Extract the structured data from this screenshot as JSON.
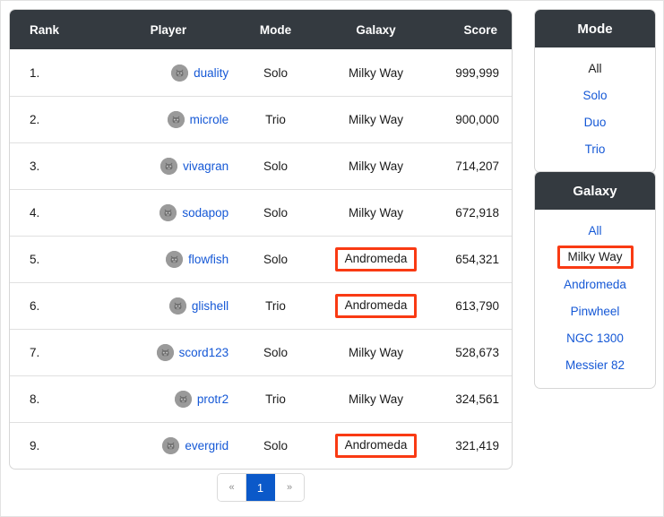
{
  "table": {
    "columns": [
      "Rank",
      "Player",
      "Mode",
      "Galaxy",
      "Score"
    ],
    "rows": [
      {
        "rank": "1.",
        "player": "duality",
        "mode": "Solo",
        "galaxy": "Milky Way",
        "score": "999,999",
        "galaxy_highlighted": false,
        "avatar": "robot-avatar-icon"
      },
      {
        "rank": "2.",
        "player": "microle",
        "mode": "Trio",
        "galaxy": "Milky Way",
        "score": "900,000",
        "galaxy_highlighted": false,
        "avatar": "robot-avatar-icon"
      },
      {
        "rank": "3.",
        "player": "vivagran",
        "mode": "Solo",
        "galaxy": "Milky Way",
        "score": "714,207",
        "galaxy_highlighted": false,
        "avatar": "robot-avatar-icon"
      },
      {
        "rank": "4.",
        "player": "sodapop",
        "mode": "Solo",
        "galaxy": "Milky Way",
        "score": "672,918",
        "galaxy_highlighted": false,
        "avatar": "robot-avatar-icon"
      },
      {
        "rank": "5.",
        "player": "flowfish",
        "mode": "Solo",
        "galaxy": "Andromeda",
        "score": "654,321",
        "galaxy_highlighted": true,
        "avatar": "robot-avatar-icon"
      },
      {
        "rank": "6.",
        "player": "glishell",
        "mode": "Trio",
        "galaxy": "Andromeda",
        "score": "613,790",
        "galaxy_highlighted": true,
        "avatar": "robot-avatar-icon"
      },
      {
        "rank": "7.",
        "player": "scord123",
        "mode": "Solo",
        "galaxy": "Milky Way",
        "score": "528,673",
        "galaxy_highlighted": false,
        "avatar": "robot-avatar-icon"
      },
      {
        "rank": "8.",
        "player": "protr2",
        "mode": "Trio",
        "galaxy": "Milky Way",
        "score": "324,561",
        "galaxy_highlighted": false,
        "avatar": "robot-avatar-icon"
      },
      {
        "rank": "9.",
        "player": "evergrid",
        "mode": "Solo",
        "galaxy": "Andromeda",
        "score": "321,419",
        "galaxy_highlighted": true,
        "avatar": "robot-avatar-icon"
      }
    ]
  },
  "pagination": {
    "prev_label": "«",
    "next_label": "»",
    "pages": [
      {
        "label": "1",
        "active": true
      }
    ],
    "current_page": "1"
  },
  "filters": {
    "mode": {
      "title": "Mode",
      "items": [
        {
          "label": "All",
          "active": true,
          "highlighted": false
        },
        {
          "label": "Solo",
          "active": false,
          "highlighted": false
        },
        {
          "label": "Duo",
          "active": false,
          "highlighted": false
        },
        {
          "label": "Trio",
          "active": false,
          "highlighted": false
        }
      ]
    },
    "galaxy": {
      "title": "Galaxy",
      "items": [
        {
          "label": "All",
          "active": false,
          "highlighted": false
        },
        {
          "label": "Milky Way",
          "active": true,
          "highlighted": true
        },
        {
          "label": "Andromeda",
          "active": false,
          "highlighted": false
        },
        {
          "label": "Pinwheel",
          "active": false,
          "highlighted": false
        },
        {
          "label": "NGC 1300",
          "active": false,
          "highlighted": false
        },
        {
          "label": "Messier 82",
          "active": false,
          "highlighted": false
        }
      ]
    }
  },
  "colors": {
    "header_bg": "#343a40",
    "link": "#1558d6",
    "highlight_outline": "#f93a13",
    "pager_active_bg": "#0b59c9",
    "avatar_bg": "#9a9a9a",
    "page_bg": "#ffffff"
  }
}
